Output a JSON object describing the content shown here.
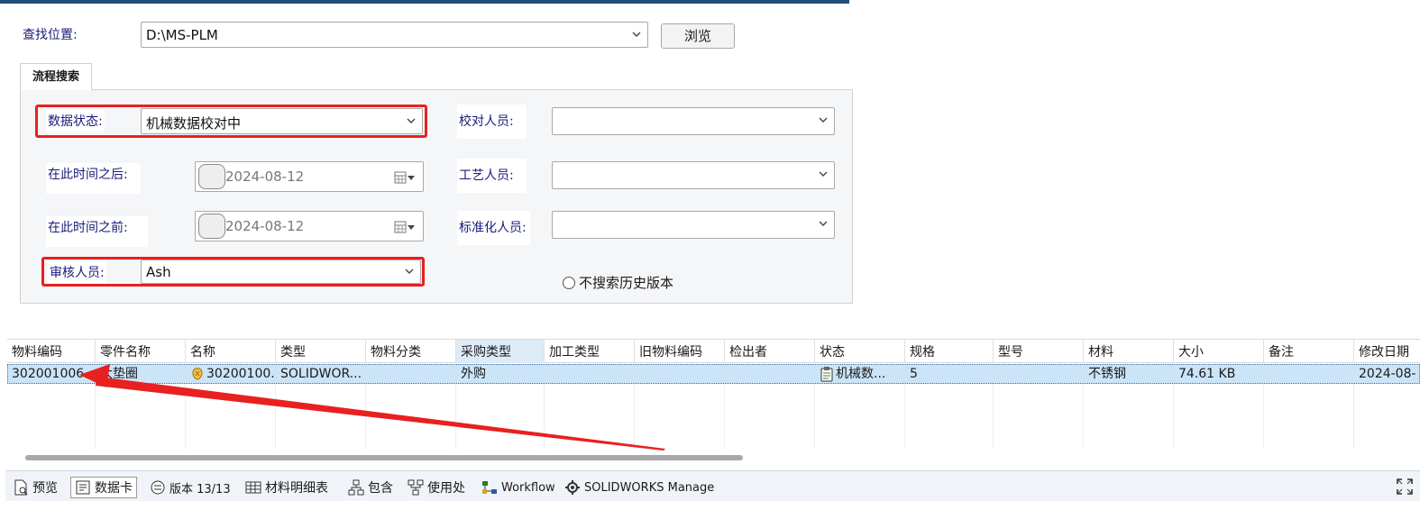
{
  "search": {
    "location_label": "查找位置:",
    "location_value": "D:\\MS-PLM",
    "browse_label": "浏览"
  },
  "tab": {
    "label": "流程搜索"
  },
  "form": {
    "data_state_label": "数据状态:",
    "data_state_value": "机械数据校对中",
    "after_label": "在此时间之后:",
    "after_value": "2024-08-12",
    "before_label": "在此时间之前:",
    "before_value": "2024-08-12",
    "reviewer_label": "审核人员:",
    "reviewer_value": "Ash",
    "checker_label": "校对人员:",
    "checker_value": "",
    "process_label": "工艺人员:",
    "process_value": "",
    "standard_label": "标准化人员:",
    "standard_value": "",
    "no_history_label": "不搜索历史版本"
  },
  "grid": {
    "columns": [
      "物料编码",
      "零件名称",
      "名称",
      "类型",
      "物料分类",
      "采购类型",
      "加工类型",
      "旧物料编码",
      "检出者",
      "状态",
      "规格",
      "型号",
      "材料",
      "大小",
      "备注",
      "修改日期"
    ],
    "row": [
      "302001006",
      "大垫圈",
      "30200100...",
      "SOLIDWOR...",
      "",
      "外购",
      "",
      "",
      "",
      "机械数...",
      "5",
      "",
      "不锈钢",
      "74.61 KB",
      "",
      "2024-08-"
    ]
  },
  "bottom_tabs": {
    "preview": "预览",
    "datacard": "数据卡",
    "version": "版本 13/13",
    "bom": "材料明细表",
    "contains": "包含",
    "where_used": "使用处",
    "workflow": "Workflow",
    "manage": "SOLIDWORKS Manage"
  },
  "colors": {
    "highlight": "#e82020",
    "selected_row": "#cce4f7",
    "header_bar": "#1f4e79"
  }
}
